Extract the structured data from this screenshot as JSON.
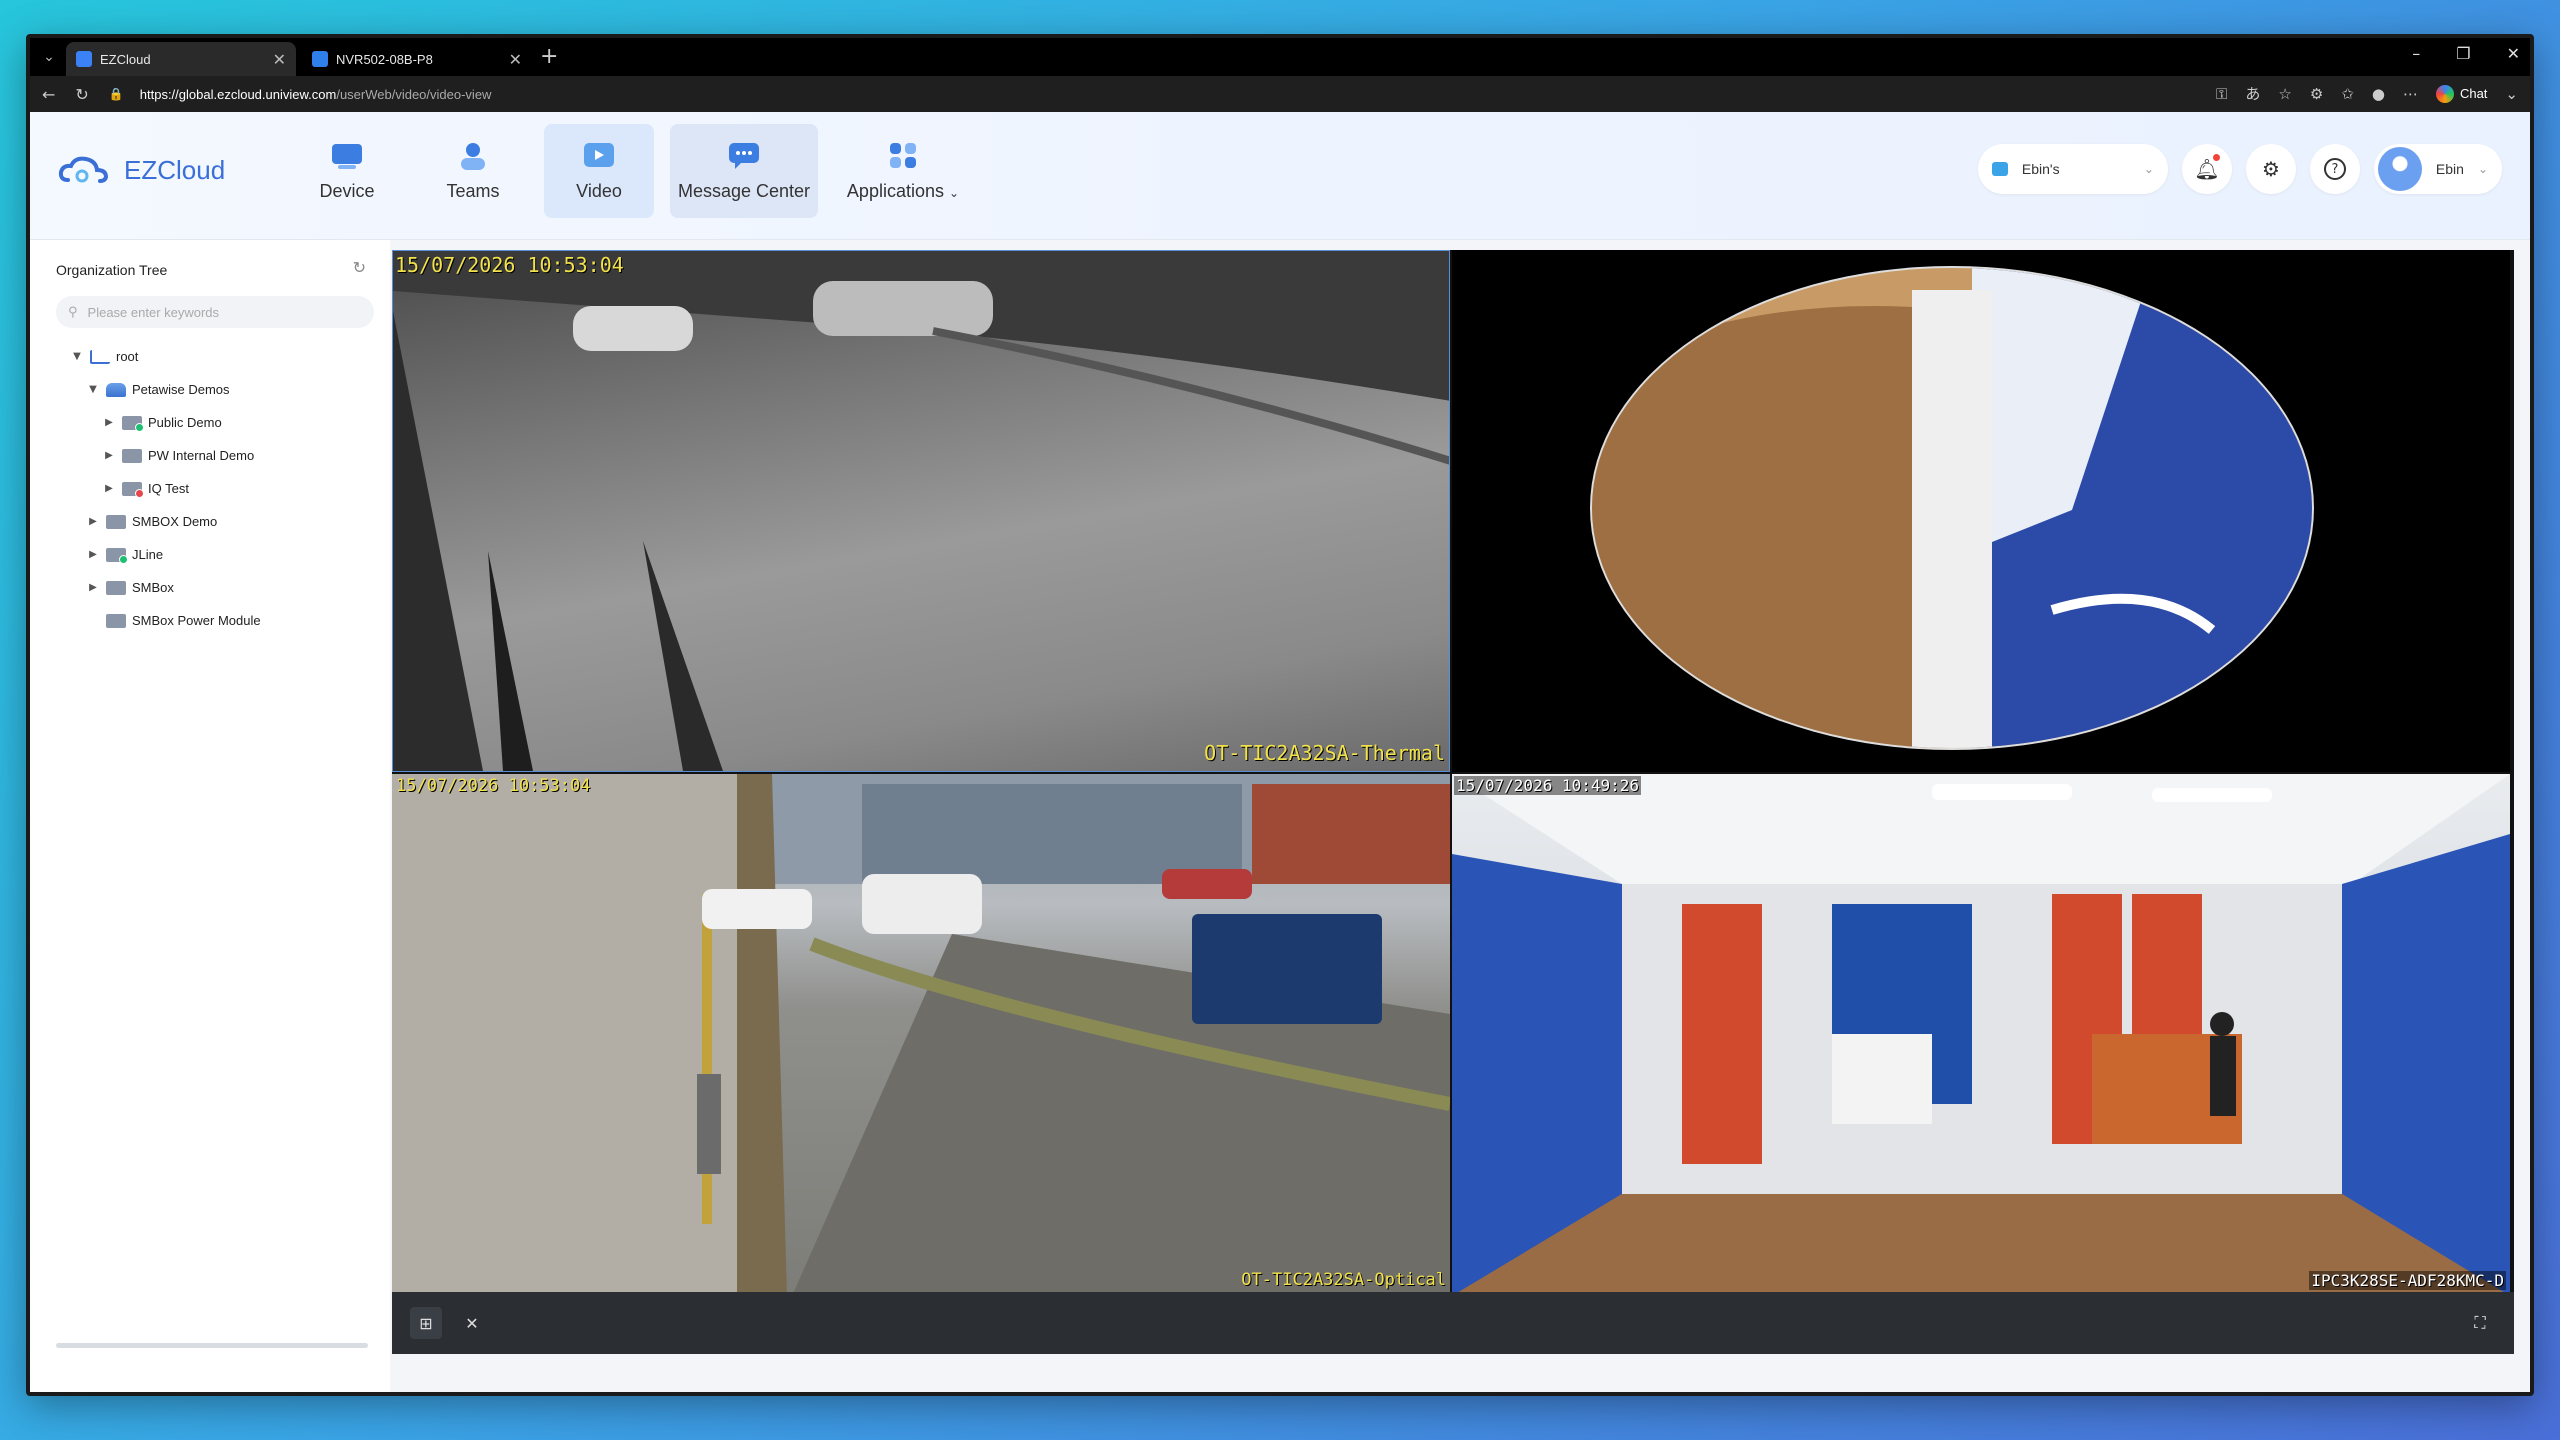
{
  "browser": {
    "tabs": [
      {
        "title": "EZCloud",
        "active": true
      },
      {
        "title": "NVR502-08B-P8",
        "active": false
      }
    ],
    "url_host": "https://global.ezcloud.uniview.com",
    "url_path": "/userWeb/video/video-view",
    "chat_label": "Chat"
  },
  "app": {
    "brand": "EZCloud",
    "nav": [
      {
        "label": "Device",
        "icon": "device-icon"
      },
      {
        "label": "Teams",
        "icon": "teams-icon"
      },
      {
        "label": "Video",
        "icon": "video-icon",
        "selected": true
      },
      {
        "label": "Message Center",
        "icon": "message-icon"
      },
      {
        "label": "Applications",
        "icon": "applications-icon"
      }
    ],
    "site_selector": "Ebin's",
    "user_name": "Ebin",
    "accent": "#3a6fd8"
  },
  "sidebar": {
    "title": "Organization Tree",
    "search_placeholder": "Please enter keywords",
    "tree": [
      {
        "label": "root"
      },
      {
        "label": "Petawise Demos"
      },
      {
        "label": "Public Demo"
      },
      {
        "label": "PW Internal Demo"
      },
      {
        "label": "IQ Test"
      },
      {
        "label": "SMBOX Demo"
      },
      {
        "label": "JLine"
      },
      {
        "label": "SMBox"
      },
      {
        "label": "SMBox Power Module"
      }
    ]
  },
  "video": {
    "cells": [
      {
        "timestamp": "15/07/2026 10:53:04",
        "camera": "OT-TIC2A32SA-Thermal"
      },
      {
        "timestamp": "",
        "camera": ""
      },
      {
        "timestamp": "15/07/2026 10:53:04",
        "camera": "OT-TIC2A32SA-Optical"
      },
      {
        "timestamp": "15/07/2026 10:49:26",
        "camera": "IPC3K28SE-ADF28KMC-D"
      }
    ]
  }
}
